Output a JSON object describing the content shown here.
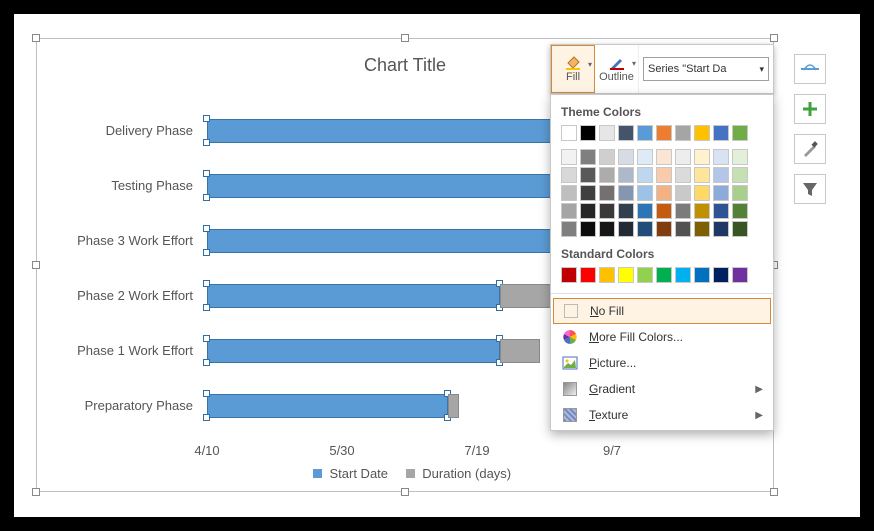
{
  "chart_data": {
    "type": "bar",
    "orientation": "horizontal",
    "stacked": true,
    "title": "Chart Title",
    "categories": [
      "Delivery Phase",
      "Testing Phase",
      "Phase 3 Work Effort",
      "Phase 2 Work Effort",
      "Phase 1 Work Effort",
      "Preparatory Phase"
    ],
    "series": [
      {
        "name": "Start Date",
        "color": "#5b9bd5",
        "values": [
          204,
          162,
          155,
          130,
          130,
          107
        ]
      },
      {
        "name": "Duration (days)",
        "color": "#a6a6a6",
        "values": [
          0,
          12,
          23,
          25,
          18,
          5
        ]
      }
    ],
    "x_ticks": [
      "4/10",
      "5/30",
      "7/19",
      "9/7"
    ],
    "x_range_days": 240
  },
  "legend": {
    "s1": "Start Date",
    "s2": "Duration (days)"
  },
  "toolbar": {
    "fill": "Fill",
    "outline": "Outline",
    "series_select": "Series \"Start Da"
  },
  "dropdown": {
    "theme_head": "Theme Colors",
    "standard_head": "Standard Colors",
    "no_fill": "o Fill",
    "no_fill_u": "N",
    "more_colors": "ore Fill Colors...",
    "more_colors_u": "M",
    "picture": "icture...",
    "picture_u": "P",
    "gradient": "radient",
    "gradient_u": "G",
    "texture": "exture",
    "texture_u": "T",
    "theme_colors": {
      "row0": [
        "#ffffff",
        "#000000",
        "#e7e6e6",
        "#44546a",
        "#5b9bd5",
        "#ed7d31",
        "#a5a5a5",
        "#ffc000",
        "#4472c4",
        "#70ad47"
      ],
      "shades": [
        [
          "#f2f2f2",
          "#7f7f7f",
          "#d0cece",
          "#d6dce4",
          "#deebf6",
          "#fbe5d5",
          "#ededed",
          "#fff2cc",
          "#d9e2f3",
          "#e2efd9"
        ],
        [
          "#d8d8d8",
          "#595959",
          "#aeabab",
          "#adb9ca",
          "#bdd7ee",
          "#f7cbac",
          "#dbdbdb",
          "#fee599",
          "#b4c6e7",
          "#c5e0b3"
        ],
        [
          "#bfbfbf",
          "#3f3f3f",
          "#757070",
          "#8496b0",
          "#9cc3e5",
          "#f4b183",
          "#c9c9c9",
          "#ffd965",
          "#8eaadb",
          "#a8d08d"
        ],
        [
          "#a5a5a5",
          "#262626",
          "#3a3838",
          "#323f4f",
          "#2e75b5",
          "#c55a11",
          "#7b7b7b",
          "#bf9000",
          "#2f5496",
          "#538135"
        ],
        [
          "#7f7f7f",
          "#0c0c0c",
          "#171616",
          "#222a35",
          "#1e4e79",
          "#833c0b",
          "#525252",
          "#7f6000",
          "#1f3864",
          "#375623"
        ]
      ]
    },
    "standard_colors": [
      "#c00000",
      "#ff0000",
      "#ffc000",
      "#ffff00",
      "#92d050",
      "#00b050",
      "#00b0f0",
      "#0070c0",
      "#002060",
      "#7030a0"
    ]
  }
}
